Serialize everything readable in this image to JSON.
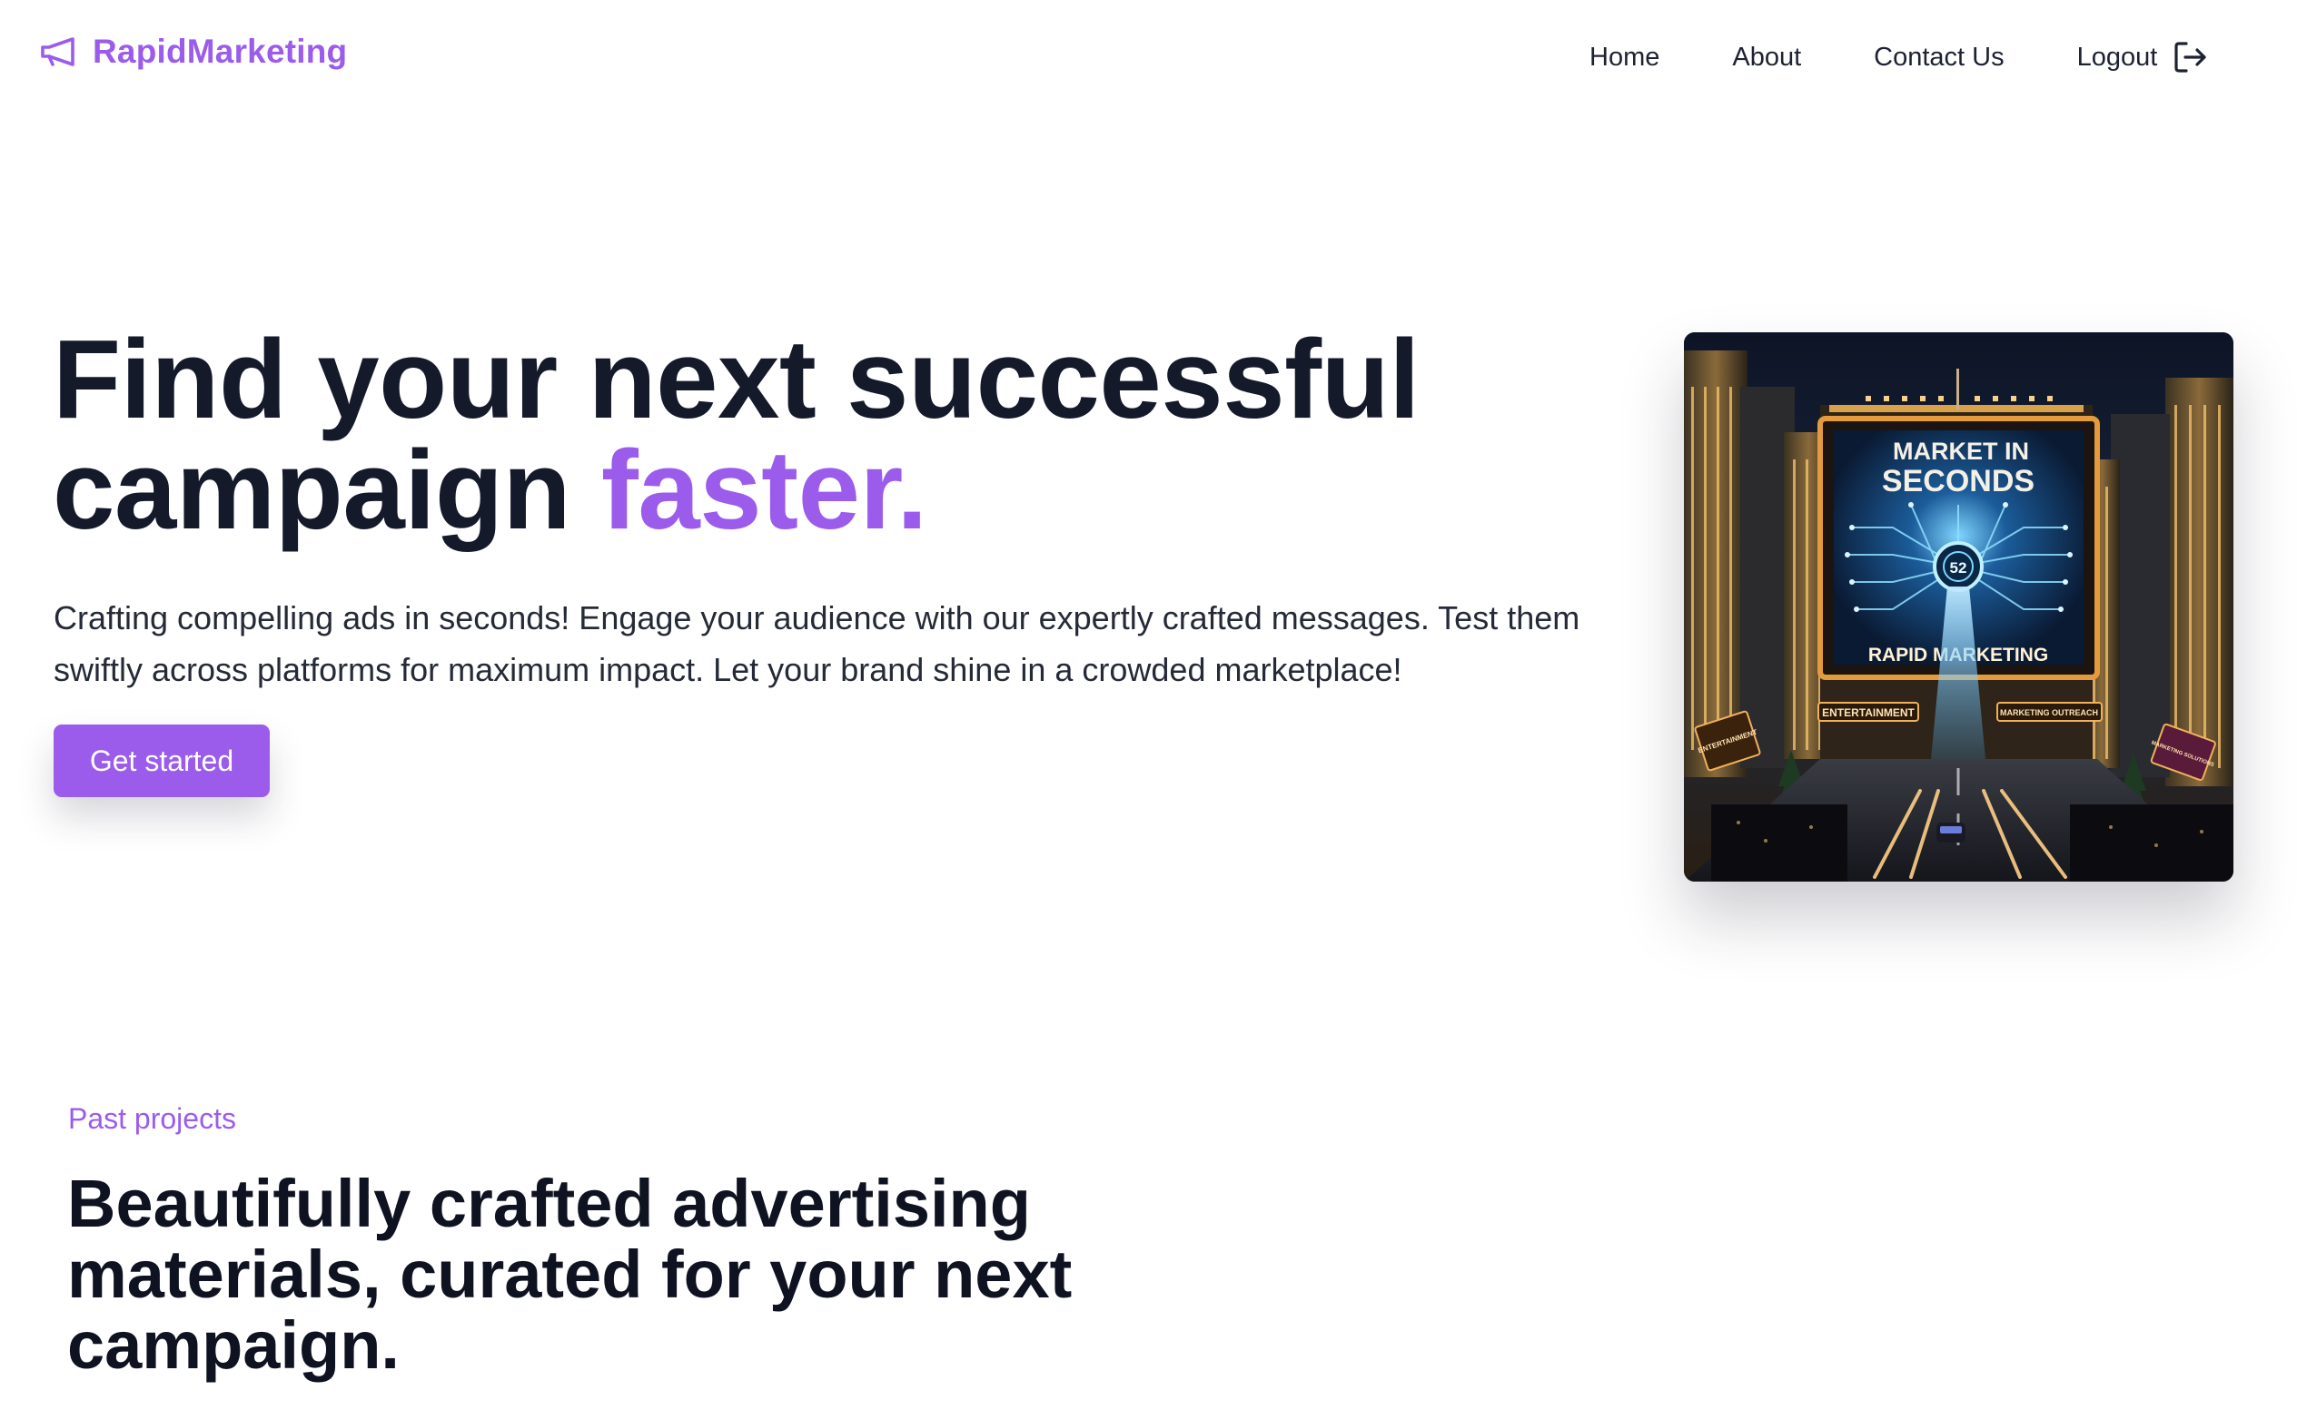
{
  "brand": {
    "name": "RapidMarketing",
    "icon": "megaphone-icon",
    "color": "#9b5cec"
  },
  "nav": {
    "home": "Home",
    "about": "About",
    "contact": "Contact Us",
    "logout": "Logout",
    "logout_icon": "logout-icon"
  },
  "hero": {
    "title_main": "Find your next successful campaign ",
    "title_accent": "faster.",
    "description": "Crafting compelling ads in seconds! Engage your audience with our expertly crafted messages. Test them swiftly across platforms for maximum impact. Let your brand shine in a crowded marketplace!",
    "cta_label": "Get started",
    "image": {
      "billboard_title_line1": "MARKET IN",
      "billboard_title_line2": "SECONDS",
      "billboard_number": "52",
      "billboard_subtitle": "RAPID MARKETING",
      "sign_left": "ENTERTAINMENT",
      "sign_right": "MARKETING OUTREACH",
      "sign_far_left": "ENTERTAINMENT",
      "sign_far_right": "MARKETING SOLUTIONS"
    }
  },
  "past_projects": {
    "eyebrow": "Past projects",
    "title": "Beautifully crafted advertising materials, curated for your next campaign."
  },
  "colors": {
    "accent": "#9b5cec",
    "text": "#151a2b"
  }
}
